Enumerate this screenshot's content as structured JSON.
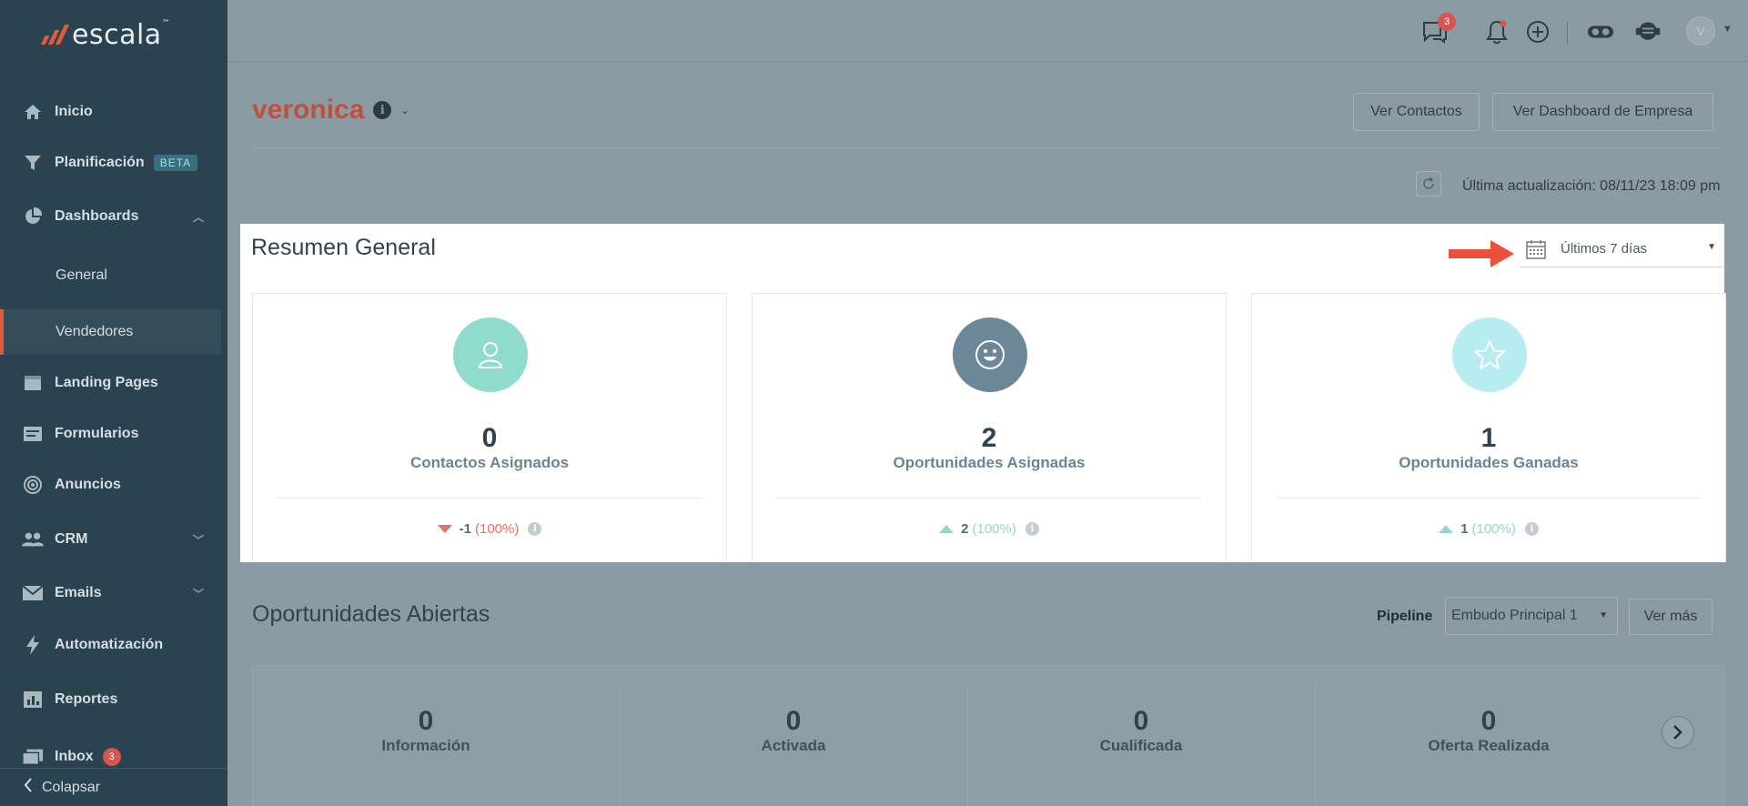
{
  "brand": {
    "name": "escala",
    "mark": "™"
  },
  "sidebar": {
    "items": [
      {
        "label": "Inicio",
        "icon": "home-icon"
      },
      {
        "label": "Planificación",
        "badge": "BETA",
        "icon": "filter-icon"
      },
      {
        "label": "Dashboards",
        "icon": "pie-chart-icon",
        "expanded": true,
        "children": [
          {
            "label": "General"
          },
          {
            "label": "Vendedores",
            "active": true
          }
        ]
      },
      {
        "label": "Landing Pages",
        "icon": "landing-page-icon"
      },
      {
        "label": "Formularios",
        "icon": "form-icon"
      },
      {
        "label": "Anuncios",
        "icon": "megaphone-icon"
      },
      {
        "label": "CRM",
        "icon": "people-icon"
      },
      {
        "label": "Emails",
        "icon": "envelope-icon"
      },
      {
        "label": "Automatización",
        "icon": "lightning-icon"
      },
      {
        "label": "Reportes",
        "icon": "report-icon"
      },
      {
        "label": "Inbox",
        "badge": "3",
        "icon": "inbox-icon"
      }
    ],
    "collapse_label": "Colapsar"
  },
  "topbar": {
    "chat_badge": "3",
    "avatar_initial": "V"
  },
  "header": {
    "user_name": "veronica",
    "buttons": {
      "contacts": "Ver Contactos",
      "company_dashboard": "Ver Dashboard de Empresa"
    },
    "last_update": "Última actualización: 08/11/23 18:09 pm"
  },
  "summary": {
    "title": "Resumen General",
    "range": "Últimos 7 días",
    "cards": [
      {
        "value": "0",
        "label": "Contactos Asignados",
        "delta": "-1",
        "pct": "(100%)",
        "trend": "down",
        "color": "#8fdccd",
        "icon": "person-icon"
      },
      {
        "value": "2",
        "label": "Oportunidades Asignadas",
        "delta": "2",
        "pct": "(100%)",
        "trend": "up",
        "color": "#6c8898",
        "icon": "smiley-icon"
      },
      {
        "value": "1",
        "label": "Oportunidades Ganadas",
        "delta": "1",
        "pct": "(100%)",
        "trend": "up",
        "color": "#b7ecf0",
        "icon": "star-icon"
      }
    ]
  },
  "open_opportunities": {
    "title": "Oportunidades Abiertas",
    "pipeline_label": "Pipeline",
    "pipeline_value": "Embudo Principal 1",
    "more_label": "Ver más",
    "stages": [
      {
        "value": "0",
        "label": "Información"
      },
      {
        "value": "0",
        "label": "Activada"
      },
      {
        "value": "0",
        "label": "Cualificada"
      },
      {
        "value": "0",
        "label": "Oferta Realizada"
      }
    ]
  },
  "colors": {
    "accent": "#e05a3d",
    "sidebar": "#2b4250",
    "overlay": "#8b9ba3"
  }
}
